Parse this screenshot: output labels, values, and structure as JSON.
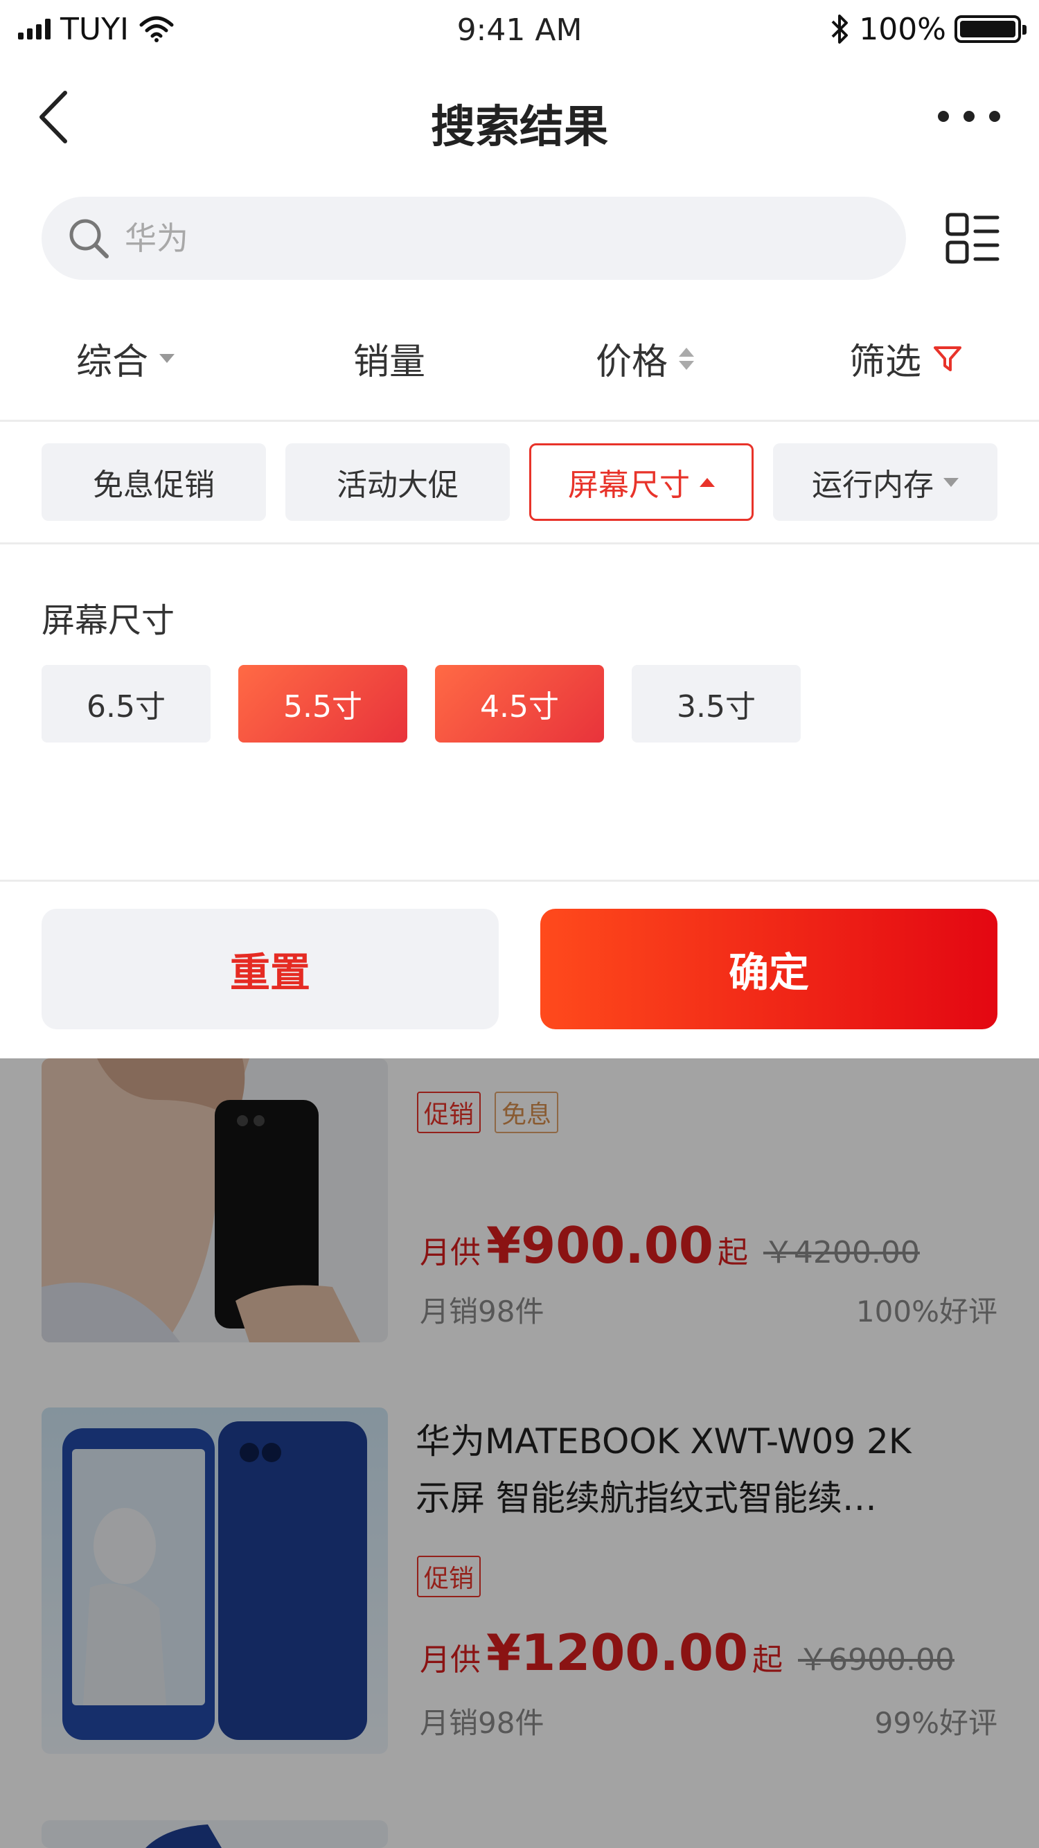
{
  "status_bar": {
    "carrier": "TUYI",
    "time": "9:41 AM",
    "battery": "100%",
    "battery_level": 1.0
  },
  "nav": {
    "title": "搜索结果"
  },
  "search": {
    "placeholder": "华为"
  },
  "sort": {
    "items": [
      {
        "label": "综合"
      },
      {
        "label": "销量"
      },
      {
        "label": "价格"
      },
      {
        "label": "筛选"
      }
    ]
  },
  "tags": [
    {
      "label": "免息促销"
    },
    {
      "label": "活动大促"
    },
    {
      "label": "屏幕尺寸",
      "active": true
    },
    {
      "label": "运行内存"
    }
  ],
  "size_panel": {
    "label": "屏幕尺寸",
    "options": [
      {
        "label": "6.5寸",
        "selected": false
      },
      {
        "label": "5.5寸",
        "selected": true
      },
      {
        "label": "4.5寸",
        "selected": true
      },
      {
        "label": "3.5寸",
        "selected": false
      }
    ]
  },
  "buttons": {
    "reset": "重置",
    "confirm": "确定"
  },
  "products": [
    {
      "badges": [
        "促销",
        "免息"
      ],
      "price_prefix": "月供",
      "price": "¥900.00",
      "price_suffix": "起",
      "old_price": "￥4200.00",
      "sales": "月销98件",
      "rating": "100%好评"
    },
    {
      "title_line1": "华为MATEBOOK XWT-W09 2K",
      "title_line2": "示屏 智能续航指纹式智能续…",
      "badges": [
        "促销"
      ],
      "price_prefix": "月供",
      "price": "¥1200.00",
      "price_suffix": "起",
      "old_price": "￥6900.00",
      "sales": "月销98件",
      "rating": "99%好评"
    }
  ],
  "colors": {
    "accent": "#e8332a",
    "confirm_start": "#ff4a1c",
    "confirm_end": "#e30712",
    "chip_bg": "#f1f2f5"
  }
}
